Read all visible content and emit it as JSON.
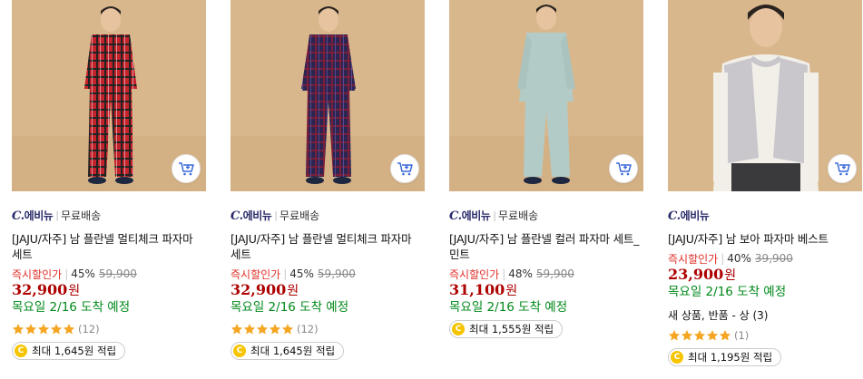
{
  "products": [
    {
      "image_icon": "man-red-plaid-pajamas",
      "seller_logo_c": "C.",
      "seller_logo_text": "에비뉴",
      "shipping": "무료배송",
      "title": "[JAJU/자주] 남 플란넬 멀티체크 파자마 세트",
      "deal_label": "즉시할인가",
      "discount": "45%",
      "original_price": "59,900",
      "price": "32,900",
      "currency": "원",
      "delivery": "목요일 2/16 도착 예정",
      "option": "",
      "rating": 5,
      "review_count": "(12)",
      "reward_coin": "C",
      "reward": "최대 1,645원 적립"
    },
    {
      "image_icon": "man-navy-plaid-pajamas",
      "seller_logo_c": "C.",
      "seller_logo_text": "에비뉴",
      "shipping": "무료배송",
      "title": "[JAJU/자주] 남 플란넬 멀티체크 파자마 세트",
      "deal_label": "즉시할인가",
      "discount": "45%",
      "original_price": "59,900",
      "price": "32,900",
      "currency": "원",
      "delivery": "목요일 2/16 도착 예정",
      "option": "",
      "rating": 5,
      "review_count": "(12)",
      "reward_coin": "C",
      "reward": "최대 1,645원 적립"
    },
    {
      "image_icon": "man-mint-pajamas",
      "seller_logo_c": "C.",
      "seller_logo_text": "에비뉴",
      "shipping": "무료배송",
      "title": "[JAJU/자주] 남 플란넬 컬러 파자마 세트_민트",
      "deal_label": "즉시할인가",
      "discount": "48%",
      "original_price": "59,900",
      "price": "31,100",
      "currency": "원",
      "delivery": "목요일 2/16 도착 예정",
      "option": "",
      "rating": 0,
      "review_count": "",
      "reward_coin": "C",
      "reward": "최대 1,555원 적립"
    },
    {
      "image_icon": "man-gray-fleece-vest",
      "seller_logo_c": "C.",
      "seller_logo_text": "에비뉴",
      "shipping": "",
      "title": "[JAJU/자주] 남 보아 파자마 베스트",
      "deal_label": "즉시할인가",
      "discount": "40%",
      "original_price": "39,900",
      "price": "23,900",
      "currency": "원",
      "delivery": "목요일 2/16 도착 예정",
      "option": "새 상품, 반품 - 상 (3)",
      "rating": 5,
      "review_count": "(1)",
      "reward_coin": "C",
      "reward": "최대 1,195원 적립"
    }
  ],
  "colors": {
    "deal": "#e0302a",
    "price": "#ae0000",
    "delivery": "#00891a",
    "star": "#f5a623",
    "coin": "#f6c400"
  }
}
